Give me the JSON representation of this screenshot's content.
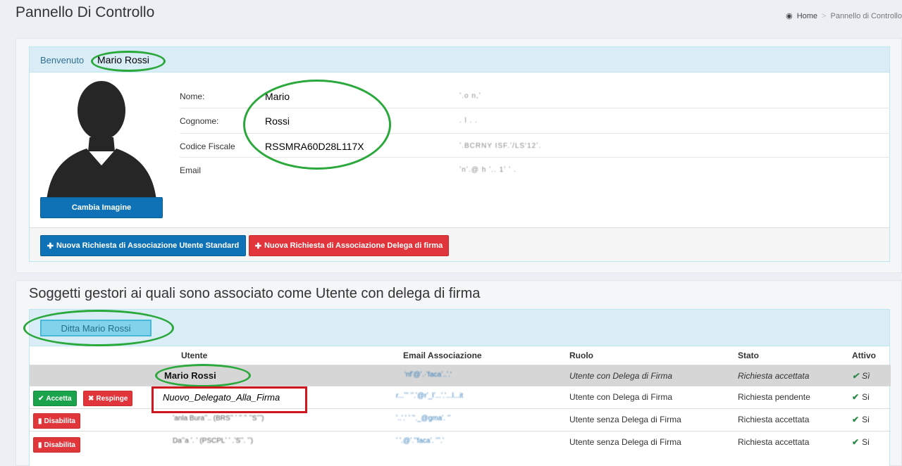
{
  "page": {
    "title": "Pannello Di Controllo",
    "breadcrumb": {
      "home": "Home",
      "separator": ">",
      "current": "Pannello di Controllo"
    }
  },
  "welcome": {
    "label": "Benvenuto",
    "user_name": "Mario Rossi",
    "change_image_button": "Cambia Imagine",
    "fields": [
      {
        "label": "Nome:",
        "value": "Mario",
        "blurred": "ʼ.o n,ʼ"
      },
      {
        "label": "Cognome:",
        "value": "Rossi",
        "blurred": ". l . ."
      },
      {
        "label": "Codice Fiscale",
        "value": "RSSMRA60D28L117X",
        "blurred": "ʼ.BCRNY ISF.ʼ/LS'12ʼ."
      },
      {
        "label": "Email",
        "value": "",
        "blurred": "ʼnʼ.@ h ʼ.. 1ʼ ʼ ."
      }
    ],
    "buttons": {
      "standard_prefix": "Nuova Richiesta di Associazione",
      "standard_strong": "Utente Standard",
      "delegate": "Nuova Richiesta di Associazione Delega di firma"
    }
  },
  "associations": {
    "section_title": "Soggetti gestori ai quali sono associato come Utente con delega di firma",
    "company_button": "Ditta Mario Rossi",
    "columns": [
      "Utente",
      "Email Associazione",
      "Ruolo",
      "Stato",
      "Attivo"
    ],
    "rows": [
      {
        "user": "Mario Rossi",
        "email": "'nfʼ@ʼ.·ʼfacaʼ..ʼ.'",
        "role": "Utente con Delega di Firma",
        "status": "Richiesta accettata",
        "active": "Sì",
        "italic": true
      },
      {
        "user": "Nuovo_Delegato_Alla_Firma",
        "email": "r...ʼʼʼ ʼʼ.ʼ@rʼ_lʼ...ʼ.ʼ...l...it",
        "role": "Utente con Delega di Firma",
        "status": "Richiesta pendente",
        "active": "Si",
        "actions": [
          "Accetta",
          "Respinge"
        ]
      },
      {
        "user": "ʼanla Buraʼʼ.. (BRSʼʼ ʼ ʼʼ ʼʼ ʼʼSʼʼʼ)",
        "email": "ʼ..ʼ.ʼ ʼ ʼʼ._@gmaʼ. ʼʼ",
        "role": "Utente senza Delega di Firma",
        "status": "Richiesta accettata",
        "active": "Si",
        "actions": [
          "Disabilita"
        ]
      },
      {
        "user": "Daʼʼa ʼ. ʼ (PSCPLʼ ʼ .ʼSʼʼ. ʼʼ)",
        "email": "ʼ ʼ.@ʼ.ʼʼfacaʼ. ʼʼʼ.ʼ",
        "role": "Utente senza Delega di Firma",
        "status": "Richiesta accettata",
        "active": "Si",
        "actions": [
          "Disabilita"
        ]
      }
    ]
  },
  "icons": {
    "home": "home-icon",
    "plus": "plus-circle-icon",
    "check": "check-icon",
    "times": "times-icon",
    "trash": "trash-icon"
  }
}
